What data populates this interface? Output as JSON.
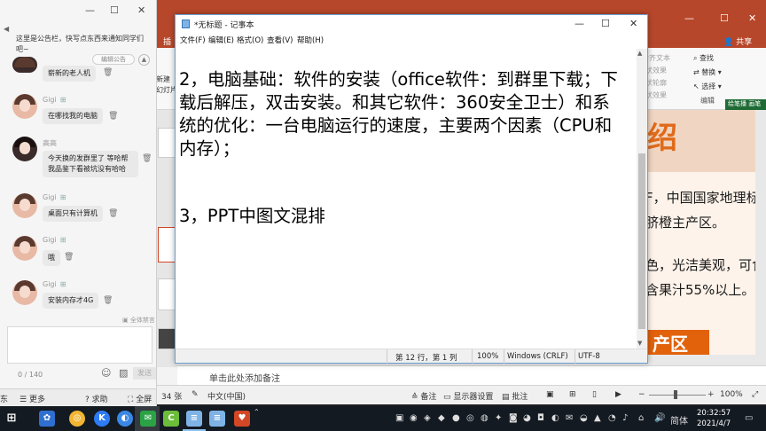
{
  "chat": {
    "notice_text": "这里是公告栏，快写点东西来通知同学们吧~",
    "edit_notice_label": "编辑公告",
    "messages": [
      {
        "user": "",
        "text": "崭新的老人机"
      },
      {
        "user": "Gigi",
        "text": "在哪找我的电脑"
      },
      {
        "user": "高高",
        "text": "今天换的发群里了 等哈帮我品鉴下看被坑没有哈哈"
      },
      {
        "user": "Gigi",
        "text": "桌面只有计算机"
      },
      {
        "user": "Gigi",
        "text": "哦"
      },
      {
        "user": "Gigi",
        "text": "安装内存才4G"
      }
    ],
    "mute_all": "全体禁言",
    "char_counter": "0 / 140",
    "send_label": "发送",
    "bottom_more": "更多",
    "bottom_help": "求助",
    "bottom_fullscreen": "全屏"
  },
  "notepad": {
    "title": "*无标题 - 记事本",
    "menu": [
      "文件(F)",
      "编辑(E)",
      "格式(O)",
      "查看(V)",
      "帮助(H)"
    ],
    "lines": [
      "2，电脑基础：软件的安装（office软件：到群里下载；下",
      "载后解压，双击安装。和其它软件：360安全卫士）和系",
      "统的优化：一台电脑运行的速度，主要两个因素（CPU和",
      "内存）；",
      "",
      "",
      "3，PPT中图文混排"
    ],
    "status_position": "第 12 行，第 1 列",
    "status_zoom": "100%",
    "status_eol": "Windows (CRLF)",
    "status_encoding": "UTF-8"
  },
  "ppt": {
    "tab_insert": "插",
    "share_label": "共享",
    "ribbon_left": [
      "新建",
      "幻灯片"
    ],
    "ribbon_gray": [
      "对齐文本",
      "状效果",
      "状轮廓",
      "状效果"
    ],
    "ribbon_find": "查找",
    "ribbon_replace": "替换",
    "ribbon_select": "选择",
    "ribbon_edit_section": "编辑",
    "floater_text": "绘笔播 画笔",
    "slide_heading": "绍",
    "slide_line1": "F，中国国家地理标",
    "slide_line2": "脐橙主产区。",
    "slide_line3": "色，光洁美观，可食",
    "slide_line4": "含果汁55%以上。",
    "slide_orange_label": "产区",
    "notes_placeholder": "单击此处添加备注",
    "status_slide_count": "34 张",
    "status_lang": "中文(中国)",
    "status_notes": "备注",
    "status_display": "显示器设置",
    "status_comments": "批注",
    "status_zoom": "100%",
    "thumb_number": "8"
  },
  "taskbar": {
    "ime_label": "简体",
    "time": "20:32:57",
    "date": "2021/4/7",
    "colors": {
      "chrome": "#f2b632",
      "kuake": "#2d7cf6",
      "wechat": "#2ba245",
      "ppt": "#d24726",
      "np": "#7fb3e6"
    }
  }
}
